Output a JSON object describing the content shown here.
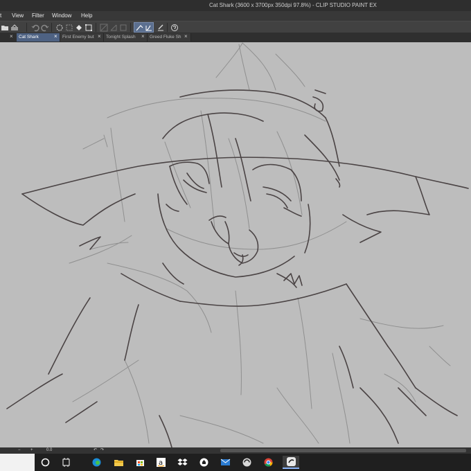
{
  "window": {
    "title": "Cat Shark (3600 x 3700px 350dpi 97.8%)  - CLIP STUDIO PAINT EX"
  },
  "menu": {
    "items": [
      "t",
      "View",
      "Filter",
      "Window",
      "Help"
    ]
  },
  "toolbar": {
    "icons": [
      "open-folder-icon",
      "save-icon",
      "undo-icon",
      "redo-icon",
      "clear-selection-icon",
      "invert-selection-icon",
      "fill-icon",
      "transform-icon",
      "ruler-icon",
      "snap-icon",
      "snap-special-icon",
      "pen-correction-icon",
      "stabilization-icon",
      "help-icon"
    ]
  },
  "tabs": [
    {
      "label": "Cat Shark",
      "active": true
    },
    {
      "label": "First Enemy but",
      "active": false
    },
    {
      "label": "Tonight Splash",
      "active": false
    },
    {
      "label": "Greed Fluke Sh",
      "active": false
    }
  ],
  "status": {
    "zoom_value": "0.0"
  },
  "taskbar": {
    "icons": [
      "windows-search",
      "cortana-icon",
      "task-view-icon",
      "edge-icon",
      "file-explorer-icon",
      "store-icon",
      "amazon-icon",
      "dropbox-icon",
      "github-icon",
      "mail-icon",
      "clip-studio-icon",
      "chrome-icon",
      "clip-studio-paint-icon"
    ]
  },
  "colors": {
    "canvas": "#bdbdbd",
    "active_tab": "#4e6283",
    "title_bar": "#2e2e2e",
    "taskbar": "#1f1f1f"
  }
}
